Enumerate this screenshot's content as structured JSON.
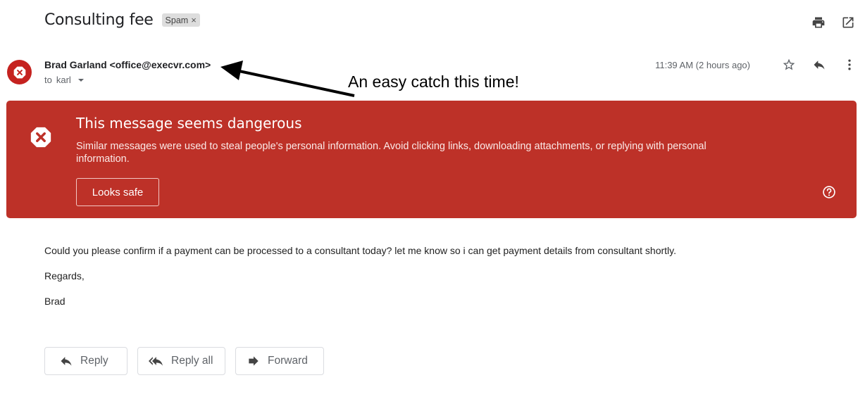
{
  "email": {
    "subject": "Consulting fee",
    "label_chip": "Spam",
    "label_chip_remove": "×",
    "sender": "Brad Garland <office@execvr.com>",
    "recipient_prefix": "to",
    "recipient": "karl",
    "timestamp": "11:39 AM (2 hours ago)",
    "body": {
      "paragraphs": [
        "Could you please confirm if a payment can be processed to a consultant today? let me know so i can get payment details from consultant shortly.",
        "Regards,",
        "Brad"
      ]
    }
  },
  "toolbar": {
    "icons": [
      "print-icon",
      "open-in-new-window-icon"
    ],
    "message_icons": [
      "star-icon",
      "reply-icon",
      "more-options-icon"
    ]
  },
  "warning": {
    "title": "This message seems dangerous",
    "body": "Similar messages were used to steal people's personal information. Avoid clicking links, downloading attachments, or replying with personal information.",
    "button_label": "Looks safe",
    "background": "#bd3128"
  },
  "annotation": {
    "text": "An easy catch this time!"
  },
  "actions": {
    "reply": "Reply",
    "reply_all": "Reply all",
    "forward": "Forward"
  },
  "colors": {
    "danger": "#c5221f",
    "warning_bg": "#bd3128",
    "secondary_text": "#5f6368"
  }
}
